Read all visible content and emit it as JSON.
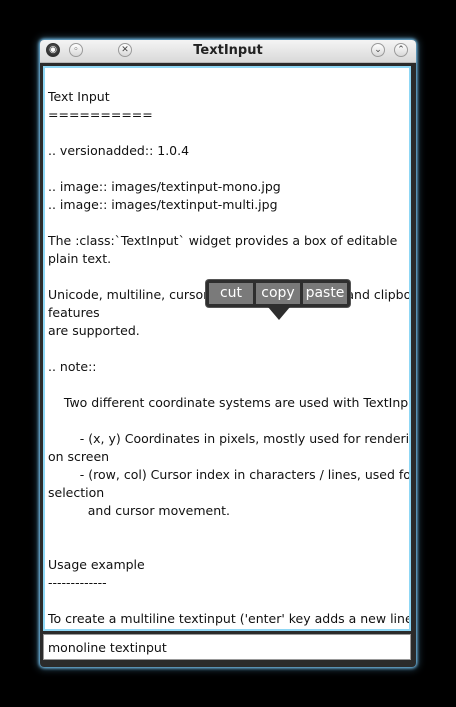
{
  "window": {
    "title": "TextInput",
    "menu_glyph": "◉",
    "minimize_glyph": "◦",
    "close_glyph": "✕",
    "shade_down_glyph": "⌄",
    "shade_up_glyph": "⌃"
  },
  "editor": {
    "lines": [
      "Text Input",
      "==========",
      "",
      ".. versionadded:: 1.0.4",
      "",
      ".. image:: images/textinput-mono.jpg",
      ".. image:: images/textinput-multi.jpg",
      "",
      "The :class:`TextInput` widget provides a box of editable",
      "plain text.",
      "",
      "Unicode, multiline, cursor navigation, selection and clipboard",
      "features",
      "are supported.",
      "",
      ".. note::",
      "",
      "    Two different coordinate systems are used with TextInput:",
      "",
      "        - (x, y) Coordinates in pixels, mostly used for rendering",
      "on screen",
      "        - (row, col) Cursor index in characters / lines, used for",
      "selection",
      "          and cursor movement.",
      "",
      "",
      "Usage example",
      "-------------",
      "",
      "To create a multiline textinput ('enter' key adds a new line)::"
    ],
    "selected_text": "igation, se"
  },
  "clipboard_bubble": {
    "cut_label": "cut",
    "copy_label": "copy",
    "paste_label": "paste"
  },
  "mono_input": {
    "value": "monoline textinput"
  },
  "colors": {
    "focus_border": "#8fd7f5",
    "selection": "#7ec8ea",
    "bubble_bg": "#2e2e2e",
    "bubble_button": "#7a7a7a"
  }
}
